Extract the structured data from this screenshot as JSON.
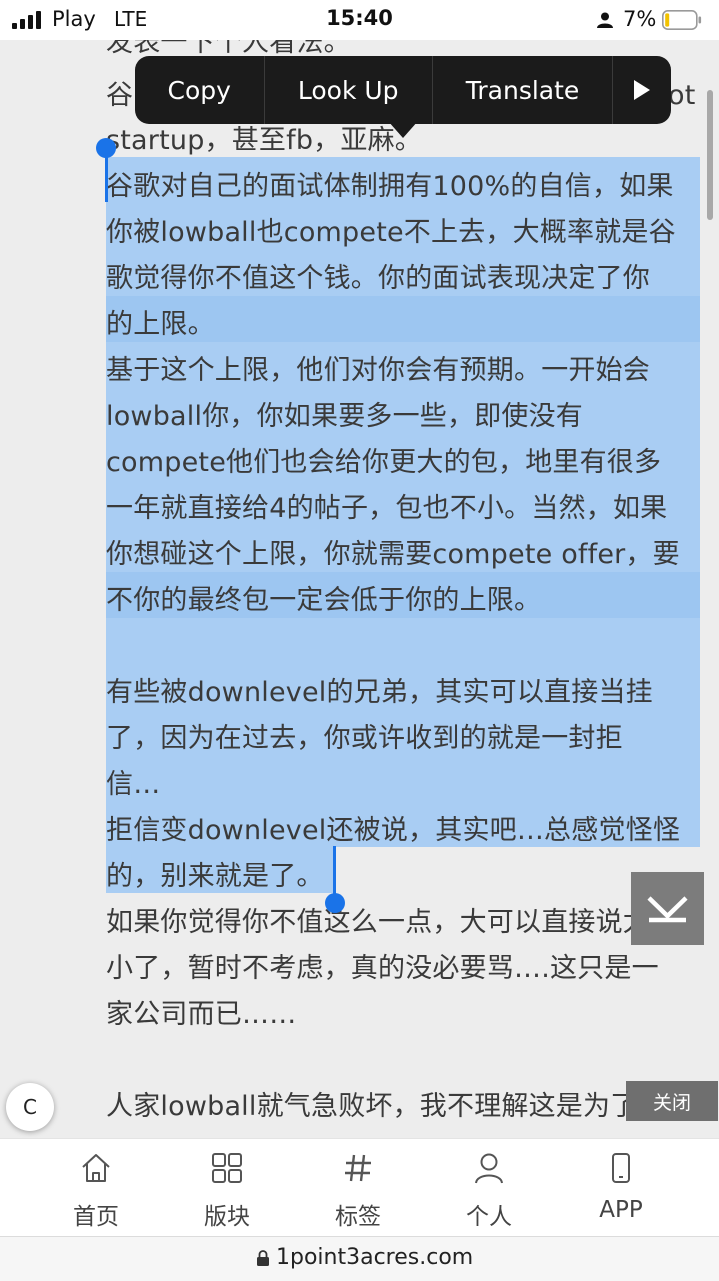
{
  "status_bar": {
    "carrier": "Play",
    "network": "LTE",
    "time": "15:40",
    "battery_percent": "7%",
    "signal_icon": "signal-bars-icon",
    "person_icon": "person-icon",
    "battery_icon": "battery-low-icon"
  },
  "context_menu": {
    "items": [
      "Copy",
      "Look Up",
      "Translate"
    ],
    "more_icon": "play-arrow-icon"
  },
  "article": {
    "lines": [
      "发表一下个人看法。",
      "谷",
      "ot",
      "startup，甚至fb，亚麻。",
      "谷歌对自己的面试体制拥有100%的自信，如果",
      "你被lowball也compete不上去，大概率就是谷",
      "歌觉得你不值这个钱。你的面试表现决定了你",
      "的上限。",
      "基于这个上限，他们对你会有预期。一开始会",
      "lowball你，你如果要多一些，即使没有",
      "compete他们也会给你更大的包，地里有很多",
      "一年就直接给4的帖子，包也不小。当然，如果",
      "你想碰这个上限，你就需要compete offer，要",
      "不你的最终包一定会低于你的上限。",
      "有些被downlevel的兄弟，其实可以直接当挂",
      "了，因为在过去，你或许收到的就是一封拒",
      "信…",
      "拒信变downlevel还被说，其实吧…总感觉怪怪",
      "的，别来就是了。",
      "如果你觉得你不值这么一点，大可以直接说太",
      "小了，暂时不考虑，真的没必要骂….这只是一",
      "家公司而已……",
      "人家lowball就气急败坏，我不理解这是为了什"
    ]
  },
  "floating": {
    "c_button": "C",
    "close_button": "关闭",
    "scroll_down_icon": "scroll-to-bottom-icon"
  },
  "bottom_nav": {
    "items": [
      {
        "label": "首页",
        "icon": "home-icon"
      },
      {
        "label": "版块",
        "icon": "grid-icon"
      },
      {
        "label": "标签",
        "icon": "hashtag-icon"
      },
      {
        "label": "个人",
        "icon": "user-icon"
      },
      {
        "label": "APP",
        "icon": "phone-icon"
      }
    ]
  },
  "url_bar": {
    "url": "1point3acres.com",
    "lock_icon": "lock-icon"
  },
  "colors": {
    "selection": "#a9cdf3",
    "selection_handle": "#1a73e8",
    "menu_bg": "#1b1b1b",
    "page_bg": "#ededed"
  }
}
